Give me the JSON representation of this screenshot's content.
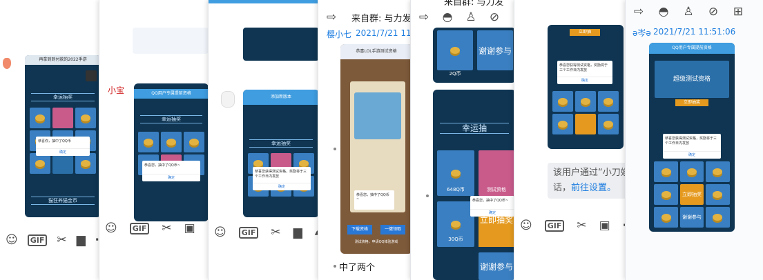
{
  "panes": {
    "p1": {
      "chat_name": "",
      "nick": "",
      "caption": "再拿到到付款的2022手游",
      "dialog": "恭喜你，抽中了QQ币",
      "ok": "确定",
      "title": "幸运抽奖",
      "footer": "砸碎金蛋都得奖",
      "subtitle": "领取主活动奖励",
      "footer2": "猫狂养猫金币"
    },
    "p2": {
      "nick": "小宝",
      "title": "QQ用户专属提前资格",
      "band": "幸运抽奖",
      "dialog": "恭喜您，抽中了QQ币~",
      "ok": "确定",
      "footer": "积分兑换卡"
    },
    "p3": {
      "title": "添加新版本",
      "band": "幸运抽奖",
      "dialog": "恭喜您获得测试资格，奖励将于三个工作日内发放",
      "ok": "确定"
    },
    "p4": {
      "header_text": "来自群: 与力发",
      "nick": "樱小七",
      "time": "2021/7/21 11:5",
      "card_title": "恭喜LOL手游测试资格",
      "card_btn1": "下载资格",
      "card_btn2": "一键领取",
      "card_note": "测试资格，申请QQ体验游戏",
      "dialog": "恭喜您，抽中了QQ币~",
      "message": "中了两个"
    },
    "p5": {
      "header_text": "来自群: 与力发",
      "coin_label": "2Q币",
      "thanks": "谢谢参与",
      "title": "幸运抽",
      "coin_label2": "648Q币",
      "test_label": "测试资格",
      "coin_label3": "30Q币",
      "big_btn": "立即抽奖",
      "dialog": "恭喜您，抽中了QQ币~",
      "ok": "确定"
    },
    "p6": {
      "dialog": "恭喜您获得测试资格，奖励将于三个工作日内发放",
      "ok": "确定",
      "btn": "立即抽",
      "sys_text": "该用户通过“小刀娱",
      "sys_text2": "话，",
      "sys_link": "前往设置。"
    },
    "p7": {
      "nick": "ə岑ə",
      "time": "2021/7/21 11:51:06",
      "title": "QQ用户专属提前资格",
      "banner": "超级测试资格",
      "btn": "立即抽奖",
      "dialog": "恭喜您获得测试资格，奖励将于三个工作日内发放",
      "ok": "确定",
      "big_btn": "立即抽奖",
      "thanks": "谢谢参与"
    }
  },
  "toolbar": {
    "gif_label": "GIF"
  },
  "icons": [
    "smile-icon",
    "gif-icon",
    "scissors-icon",
    "folder-icon",
    "image-icon",
    "more-icon",
    "forward-icon",
    "hide-icon",
    "add-user-icon",
    "mute-icon",
    "add-note-icon"
  ]
}
